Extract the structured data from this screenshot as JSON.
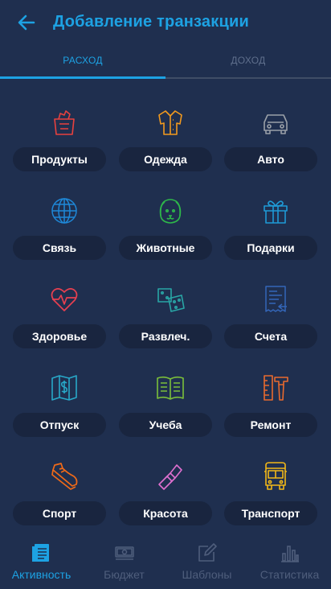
{
  "header": {
    "title": "Добавление транзакции"
  },
  "tabs": {
    "expense": "РАСХОД",
    "income": "ДОХОД"
  },
  "categories": [
    "Продукты",
    "Одежда",
    "Авто",
    "Связь",
    "Животные",
    "Подарки",
    "Здоровье",
    "Развлеч.",
    "Счета",
    "Отпуск",
    "Учеба",
    "Ремонт",
    "Спорт",
    "Красота",
    "Транспорт"
  ],
  "icons": [
    "grocery-bag-icon",
    "shirt-icon",
    "car-icon",
    "globe-icon",
    "dog-icon",
    "gift-icon",
    "heart-pulse-icon",
    "dice-icon",
    "bill-icon",
    "map-dollar-icon",
    "open-book-icon",
    "tools-icon",
    "sneaker-icon",
    "lipstick-icon",
    "bus-icon"
  ],
  "icon_colors": [
    "#e8413e",
    "#f29a1e",
    "#9aa0a8",
    "#1e88d8",
    "#2eb84a",
    "#1f9ad6",
    "#e84050",
    "#29a6a6",
    "#3466b8",
    "#28a8c8",
    "#7bbf3a",
    "#e96a2e",
    "#f06a18",
    "#e070d0",
    "#f2b818"
  ],
  "bottom_nav": [
    {
      "label": "Активность",
      "icon": "activity-icon",
      "active": true
    },
    {
      "label": "Бюджет",
      "icon": "budget-icon",
      "active": false
    },
    {
      "label": "Шаблоны",
      "icon": "templates-icon",
      "active": false
    },
    {
      "label": "Статистика",
      "icon": "statistics-icon",
      "active": false
    }
  ],
  "colors": {
    "accent": "#1da2e3",
    "background": "#1f2f4f",
    "pill": "#19253f",
    "inactive": "#4f5e7c"
  }
}
